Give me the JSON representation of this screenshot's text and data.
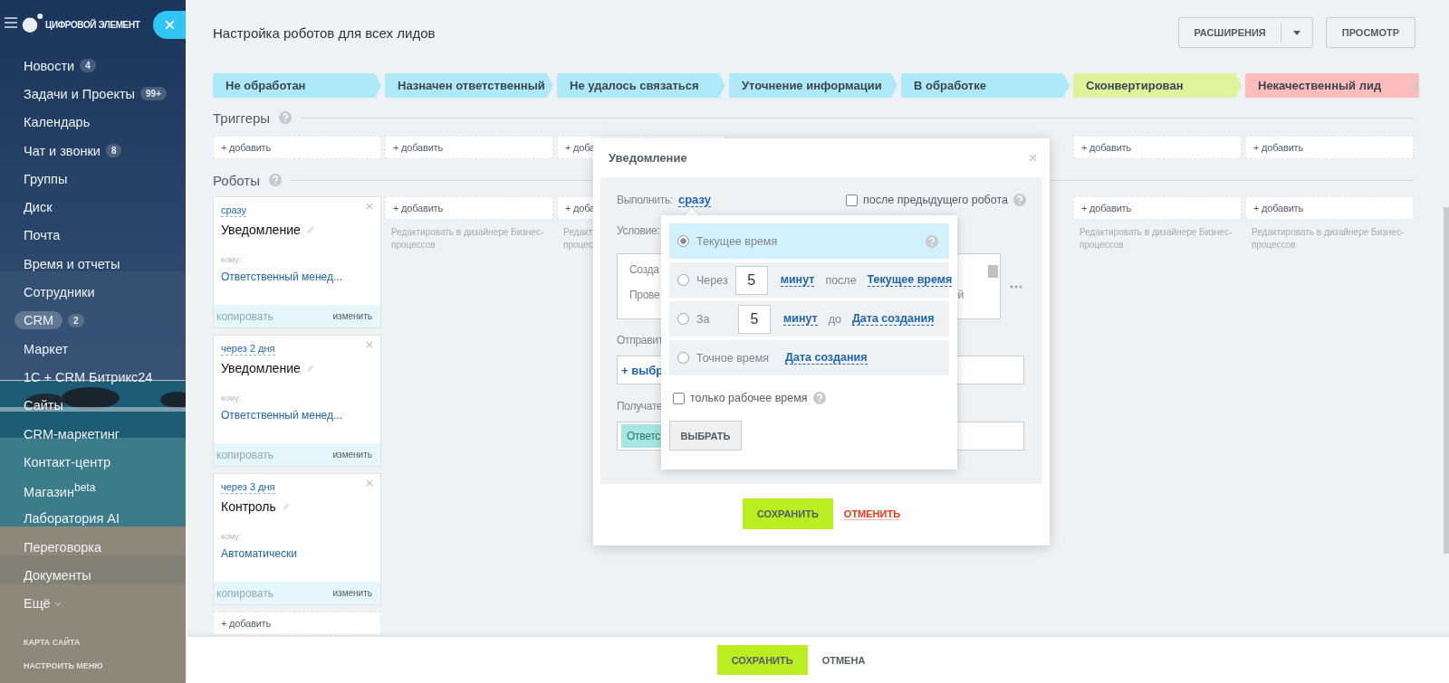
{
  "sidebar": {
    "logo": "ЦИФРОВОЙ ЭЛЕМЕНТ",
    "items": [
      {
        "label": "Новости",
        "count": "4",
        "selected": false
      },
      {
        "label": "Задачи и Проекты",
        "count": "99+",
        "selected": false
      },
      {
        "label": "Календарь",
        "selected": false
      },
      {
        "label": "Чат и звонки",
        "count": "8",
        "selected": false
      },
      {
        "label": "Группы",
        "selected": false
      },
      {
        "label": "Диск",
        "selected": false
      },
      {
        "label": "Почта",
        "selected": false
      },
      {
        "label": "Время и отчеты",
        "selected": false
      },
      {
        "label": "Сотрудники",
        "selected": false
      },
      {
        "label": "CRM",
        "count": "2",
        "selected": true
      },
      {
        "label": "Маркет",
        "selected": false
      },
      {
        "label": "1С + CRM Битрикс24",
        "selected": false
      },
      {
        "label": "Сайты",
        "selected": false
      },
      {
        "label": "CRM-маркетинг",
        "selected": false
      },
      {
        "label": "Контакт-центр",
        "selected": false
      },
      {
        "label": "Магазин$^{beta}$",
        "selected": false
      },
      {
        "label": "Лаборатория AI",
        "selected": false
      },
      {
        "label": "Переговорка",
        "selected": false
      },
      {
        "label": "Документы",
        "selected": false
      },
      {
        "label": "Ещё",
        "selected": false
      }
    ],
    "footer_links": [
      "КАРТА САЙТА",
      "НАСТРОИТЬ МЕНЮ"
    ]
  },
  "header": {
    "title": "Настройка роботов для всех лидов",
    "extensions_button": "РАСШИРЕНИЯ",
    "preview_button": "ПРОСМОТР"
  },
  "stages": [
    {
      "label": "Не обработан",
      "color": "#aee9fa"
    },
    {
      "label": "Назначен ответственный",
      "color": "#aee9fa"
    },
    {
      "label": "Не удалось связаться",
      "color": "#aee9fa"
    },
    {
      "label": "Уточнение информации",
      "color": "#aee9fa"
    },
    {
      "label": "В обработке",
      "color": "#aee9fa"
    },
    {
      "label": "Сконвертирован",
      "color": "#ddf49b"
    },
    {
      "label": "Некачественный лид",
      "color": "#ffbcbc"
    }
  ],
  "triggers": {
    "title": "Триггеры",
    "columns": [
      {
        "add": "+ добавить"
      },
      {
        "add": "+ добавить"
      },
      {
        "add": "+ доба"
      },
      {},
      {},
      {
        "add": "+ добавить"
      },
      {
        "add": "+ добавить"
      }
    ]
  },
  "robots": {
    "title": "Роботы",
    "columns": [
      {
        "cards": [
          {
            "delay": "сразу",
            "name": "Уведомление",
            "to_label": "кому:",
            "to": "Ответственный менед...",
            "copy": "копировать",
            "edit": "изменить"
          },
          {
            "delay": "через 2 дня",
            "name": "Уведомление",
            "to_label": "кому:",
            "to": "Ответственный менед...",
            "copy": "копировать",
            "edit": "изменить"
          },
          {
            "delay": "через 3 дня",
            "name": "Контроль",
            "to_label": "кому:",
            "to": "Автоматически",
            "copy": "копировать",
            "edit": "изменить"
          }
        ],
        "add": "+ добавить"
      },
      {
        "add": "+ добавить",
        "hint": "Редактировать в дизайнере Бизнес-процессов"
      },
      {
        "add": "+ доба",
        "hint": "Редакт\nпроцес"
      },
      {},
      {},
      {
        "add": "+ добавить",
        "hint": "Редактировать в дизайнере Бизнес-процессов"
      },
      {
        "add": "+ добавить",
        "hint": "Редактировать в дизайнере Бизнес-процессов"
      }
    ]
  },
  "dialog": {
    "title": "Уведомление",
    "run_label": "Выполнить:",
    "run_value": "сразу",
    "after_previous": {
      "label": "после предыдущего робота",
      "checked": false
    },
    "condition_label": "Условие:",
    "message_lines": [
      {
        "left": "Созда"
      },
      {
        "left": "Прове",
        "right": "й"
      }
    ],
    "sender_label": "Отправит",
    "sender_add": "+ выбр",
    "recipient_label": "Получате",
    "recipient_tag": "Ответс",
    "save": "СОХРАНИТЬ",
    "cancel": "ОТМЕНИТЬ",
    "time_picker": {
      "options": [
        {
          "kind": "now",
          "label": "Текущее время",
          "selected": true
        },
        {
          "kind": "after",
          "label": "Через",
          "amount": "5",
          "unit": "минут",
          "relation": "после",
          "base": "Текущее время",
          "selected": false
        },
        {
          "kind": "before",
          "label": "За",
          "amount": "5",
          "unit": "минут",
          "relation": "до",
          "base": "Дата создания",
          "selected": false
        },
        {
          "kind": "exact",
          "label": "Точное время",
          "base": "Дата создания",
          "selected": false
        }
      ],
      "work_time": {
        "label": "только рабочее время",
        "checked": false
      },
      "choose": "ВЫБРАТЬ"
    }
  },
  "footer": {
    "save": "СОХРАНИТЬ",
    "cancel": "ОТМЕНА"
  }
}
